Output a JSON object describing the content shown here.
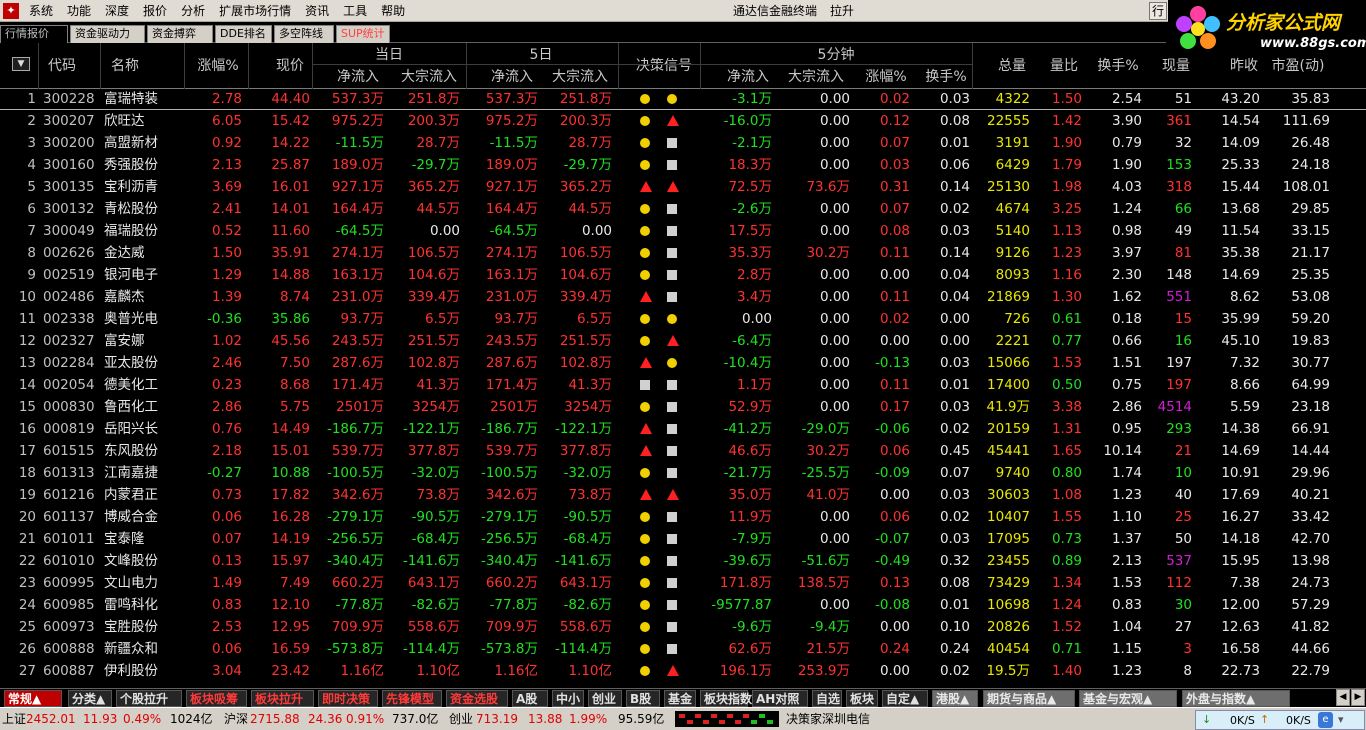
{
  "menubar": {
    "logo_icon": "app-logo-icon",
    "items": [
      "系统",
      "功能",
      "深度",
      "报价",
      "分析",
      "扩展市场行情",
      "资讯",
      "工具",
      "帮助"
    ],
    "app_title": "通达信金融终端",
    "pull_label": "拉升",
    "corner_label": "行"
  },
  "brand": {
    "text": "分析家公式网",
    "url": "www.88gs.com"
  },
  "top_tabs": [
    "行情报价",
    "资金驱动力",
    "资金搏弈",
    "DDE排名",
    "多空阵线",
    "SUP统计"
  ],
  "header": {
    "group_today": "当日",
    "group_5day": "5日",
    "group_5min": "5分钟",
    "code": "代码",
    "name": "名称",
    "pct": "涨幅%",
    "price": "现价",
    "net_inflow": "净流入",
    "block_inflow": "大宗流入",
    "signal": "决策信号",
    "pct5": "涨幅%",
    "turnover5": "换手%",
    "volume": "总量",
    "vol_ratio": "量比",
    "turnover": "换手%",
    "cur_vol": "现量",
    "prev_close": "昨收",
    "pe": "市盈(动)"
  },
  "colors": {
    "up": "#ff3232",
    "down": "#20e020",
    "flat": "#e8e8e8",
    "volume": "#e8e800",
    "magenta": "#d020d0",
    "signal_circle": "#f0d000",
    "signal_square": "#d0d0d0",
    "signal_triangle": "#ff2020"
  },
  "rows": [
    {
      "n": "1",
      "code": "300228",
      "name": "富瑞特装",
      "pct": "2.78",
      "price": "44.40",
      "t_net": "537.3万",
      "t_blk": "251.8万",
      "d_net": "537.3万",
      "d_blk": "251.8万",
      "s1": "circle",
      "s2": "circle",
      "m_net": "-3.1万",
      "m_blk": "0.00",
      "m_pct": "0.02",
      "m_to": "0.03",
      "vol": "4322",
      "vr": "1.50",
      "to": "2.54",
      "cv": "51",
      "pc": "43.20",
      "pe": "35.83"
    },
    {
      "n": "2",
      "code": "300207",
      "name": "欣旺达",
      "pct": "6.05",
      "price": "15.42",
      "t_net": "975.2万",
      "t_blk": "200.3万",
      "d_net": "975.2万",
      "d_blk": "200.3万",
      "s1": "circle",
      "s2": "triangle",
      "m_net": "-16.0万",
      "m_blk": "0.00",
      "m_pct": "0.12",
      "m_to": "0.08",
      "vol": "22555",
      "vr": "1.42",
      "to": "3.90",
      "cv": "361",
      "pc": "14.54",
      "pe": "111.69"
    },
    {
      "n": "3",
      "code": "300200",
      "name": "高盟新材",
      "pct": "0.92",
      "price": "14.22",
      "t_net": "-11.5万",
      "t_blk": "28.7万",
      "d_net": "-11.5万",
      "d_blk": "28.7万",
      "s1": "circle",
      "s2": "square",
      "m_net": "-2.1万",
      "m_blk": "0.00",
      "m_pct": "0.07",
      "m_to": "0.01",
      "vol": "3191",
      "vr": "1.90",
      "to": "0.79",
      "cv": "32",
      "pc": "14.09",
      "pe": "26.48"
    },
    {
      "n": "4",
      "code": "300160",
      "name": "秀强股份",
      "pct": "2.13",
      "price": "25.87",
      "t_net": "189.0万",
      "t_blk": "-29.7万",
      "d_net": "189.0万",
      "d_blk": "-29.7万",
      "s1": "circle",
      "s2": "square",
      "m_net": "18.3万",
      "m_blk": "0.00",
      "m_pct": "0.03",
      "m_to": "0.06",
      "vol": "6429",
      "vr": "1.79",
      "to": "1.90",
      "cv": "153",
      "pc": "25.33",
      "pe": "24.18"
    },
    {
      "n": "5",
      "code": "300135",
      "name": "宝利沥青",
      "pct": "3.69",
      "price": "16.01",
      "t_net": "927.1万",
      "t_blk": "365.2万",
      "d_net": "927.1万",
      "d_blk": "365.2万",
      "s1": "triangle",
      "s2": "triangle",
      "m_net": "72.5万",
      "m_blk": "73.6万",
      "m_pct": "0.31",
      "m_to": "0.14",
      "vol": "25130",
      "vr": "1.98",
      "to": "4.03",
      "cv": "318",
      "pc": "15.44",
      "pe": "108.01"
    },
    {
      "n": "6",
      "code": "300132",
      "name": "青松股份",
      "pct": "2.41",
      "price": "14.01",
      "t_net": "164.4万",
      "t_blk": "44.5万",
      "d_net": "164.4万",
      "d_blk": "44.5万",
      "s1": "circle",
      "s2": "square",
      "m_net": "-2.6万",
      "m_blk": "0.00",
      "m_pct": "0.07",
      "m_to": "0.02",
      "vol": "4674",
      "vr": "3.25",
      "to": "1.24",
      "cv": "66",
      "pc": "13.68",
      "pe": "29.85"
    },
    {
      "n": "7",
      "code": "300049",
      "name": "福瑞股份",
      "pct": "0.52",
      "price": "11.60",
      "t_net": "-64.5万",
      "t_blk": "0.00",
      "d_net": "-64.5万",
      "d_blk": "0.00",
      "s1": "circle",
      "s2": "square",
      "m_net": "17.5万",
      "m_blk": "0.00",
      "m_pct": "0.08",
      "m_to": "0.03",
      "vol": "5140",
      "vr": "1.13",
      "to": "0.98",
      "cv": "49",
      "pc": "11.54",
      "pe": "33.15"
    },
    {
      "n": "8",
      "code": "002626",
      "name": "金达威",
      "pct": "1.50",
      "price": "35.91",
      "t_net": "274.1万",
      "t_blk": "106.5万",
      "d_net": "274.1万",
      "d_blk": "106.5万",
      "s1": "circle",
      "s2": "square",
      "m_net": "35.3万",
      "m_blk": "30.2万",
      "m_pct": "0.11",
      "m_to": "0.14",
      "vol": "9126",
      "vr": "1.23",
      "to": "3.97",
      "cv": "81",
      "pc": "35.38",
      "pe": "21.17"
    },
    {
      "n": "9",
      "code": "002519",
      "name": "银河电子",
      "pct": "1.29",
      "price": "14.88",
      "t_net": "163.1万",
      "t_blk": "104.6万",
      "d_net": "163.1万",
      "d_blk": "104.6万",
      "s1": "circle",
      "s2": "square",
      "m_net": "2.8万",
      "m_blk": "0.00",
      "m_pct": "0.00",
      "m_to": "0.04",
      "vol": "8093",
      "vr": "1.16",
      "to": "2.30",
      "cv": "148",
      "pc": "14.69",
      "pe": "25.35"
    },
    {
      "n": "10",
      "code": "002486",
      "name": "嘉麟杰",
      "pct": "1.39",
      "price": "8.74",
      "t_net": "231.0万",
      "t_blk": "339.4万",
      "d_net": "231.0万",
      "d_blk": "339.4万",
      "s1": "triangle",
      "s2": "square",
      "m_net": "3.4万",
      "m_blk": "0.00",
      "m_pct": "0.11",
      "m_to": "0.04",
      "vol": "21869",
      "vr": "1.30",
      "to": "1.62",
      "cv": "551",
      "pc": "8.62",
      "pe": "53.08"
    },
    {
      "n": "11",
      "code": "002338",
      "name": "奥普光电",
      "pct": "-0.36",
      "price": "35.86",
      "t_net": "93.7万",
      "t_blk": "6.5万",
      "d_net": "93.7万",
      "d_blk": "6.5万",
      "s1": "circle",
      "s2": "circle",
      "m_net": "0.00",
      "m_blk": "0.00",
      "m_pct": "0.02",
      "m_to": "0.00",
      "vol": "726",
      "vr": "0.61",
      "to": "0.18",
      "cv": "15",
      "pc": "35.99",
      "pe": "59.20"
    },
    {
      "n": "12",
      "code": "002327",
      "name": "富安娜",
      "pct": "1.02",
      "price": "45.56",
      "t_net": "243.5万",
      "t_blk": "251.5万",
      "d_net": "243.5万",
      "d_blk": "251.5万",
      "s1": "circle",
      "s2": "triangle",
      "m_net": "-6.4万",
      "m_blk": "0.00",
      "m_pct": "0.00",
      "m_to": "0.00",
      "vol": "2221",
      "vr": "0.77",
      "to": "0.66",
      "cv": "16",
      "pc": "45.10",
      "pe": "19.83"
    },
    {
      "n": "13",
      "code": "002284",
      "name": "亚太股份",
      "pct": "2.46",
      "price": "7.50",
      "t_net": "287.6万",
      "t_blk": "102.8万",
      "d_net": "287.6万",
      "d_blk": "102.8万",
      "s1": "triangle",
      "s2": "circle",
      "m_net": "-10.4万",
      "m_blk": "0.00",
      "m_pct": "-0.13",
      "m_to": "0.03",
      "vol": "15066",
      "vr": "1.53",
      "to": "1.51",
      "cv": "197",
      "pc": "7.32",
      "pe": "30.77"
    },
    {
      "n": "14",
      "code": "002054",
      "name": "德美化工",
      "pct": "0.23",
      "price": "8.68",
      "t_net": "171.4万",
      "t_blk": "41.3万",
      "d_net": "171.4万",
      "d_blk": "41.3万",
      "s1": "square",
      "s2": "square",
      "m_net": "1.1万",
      "m_blk": "0.00",
      "m_pct": "0.11",
      "m_to": "0.01",
      "vol": "17400",
      "vr": "0.50",
      "to": "0.75",
      "cv": "197",
      "pc": "8.66",
      "pe": "64.99"
    },
    {
      "n": "15",
      "code": "000830",
      "name": "鲁西化工",
      "pct": "2.86",
      "price": "5.75",
      "t_net": "2501万",
      "t_blk": "3254万",
      "d_net": "2501万",
      "d_blk": "3254万",
      "s1": "circle",
      "s2": "square",
      "m_net": "52.9万",
      "m_blk": "0.00",
      "m_pct": "0.17",
      "m_to": "0.03",
      "vol": "41.9万",
      "vr": "3.38",
      "to": "2.86",
      "cv": "4514",
      "pc": "5.59",
      "pe": "23.18"
    },
    {
      "n": "16",
      "code": "000819",
      "name": "岳阳兴长",
      "pct": "0.76",
      "price": "14.49",
      "t_net": "-186.7万",
      "t_blk": "-122.1万",
      "d_net": "-186.7万",
      "d_blk": "-122.1万",
      "s1": "triangle",
      "s2": "square",
      "m_net": "-41.2万",
      "m_blk": "-29.0万",
      "m_pct": "-0.06",
      "m_to": "0.02",
      "vol": "20159",
      "vr": "1.31",
      "to": "0.95",
      "cv": "293",
      "pc": "14.38",
      "pe": "66.91"
    },
    {
      "n": "17",
      "code": "601515",
      "name": "东风股份",
      "pct": "2.18",
      "price": "15.01",
      "t_net": "539.7万",
      "t_blk": "377.8万",
      "d_net": "539.7万",
      "d_blk": "377.8万",
      "s1": "triangle",
      "s2": "square",
      "m_net": "46.6万",
      "m_blk": "30.2万",
      "m_pct": "0.06",
      "m_to": "0.45",
      "vol": "45441",
      "vr": "1.65",
      "to": "10.14",
      "cv": "21",
      "pc": "14.69",
      "pe": "14.44"
    },
    {
      "n": "18",
      "code": "601313",
      "name": "江南嘉捷",
      "pct": "-0.27",
      "price": "10.88",
      "t_net": "-100.5万",
      "t_blk": "-32.0万",
      "d_net": "-100.5万",
      "d_blk": "-32.0万",
      "s1": "circle",
      "s2": "square",
      "m_net": "-21.7万",
      "m_blk": "-25.5万",
      "m_pct": "-0.09",
      "m_to": "0.07",
      "vol": "9740",
      "vr": "0.80",
      "to": "1.74",
      "cv": "10",
      "pc": "10.91",
      "pe": "29.96"
    },
    {
      "n": "19",
      "code": "601216",
      "name": "内蒙君正",
      "pct": "0.73",
      "price": "17.82",
      "t_net": "342.6万",
      "t_blk": "73.8万",
      "d_net": "342.6万",
      "d_blk": "73.8万",
      "s1": "triangle",
      "s2": "triangle",
      "m_net": "35.0万",
      "m_blk": "41.0万",
      "m_pct": "0.00",
      "m_to": "0.03",
      "vol": "30603",
      "vr": "1.08",
      "to": "1.23",
      "cv": "40",
      "pc": "17.69",
      "pe": "40.21"
    },
    {
      "n": "20",
      "code": "601137",
      "name": "博威合金",
      "pct": "0.06",
      "price": "16.28",
      "t_net": "-279.1万",
      "t_blk": "-90.5万",
      "d_net": "-279.1万",
      "d_blk": "-90.5万",
      "s1": "circle",
      "s2": "square",
      "m_net": "11.9万",
      "m_blk": "0.00",
      "m_pct": "0.06",
      "m_to": "0.02",
      "vol": "10407",
      "vr": "1.55",
      "to": "1.10",
      "cv": "25",
      "pc": "16.27",
      "pe": "33.42"
    },
    {
      "n": "21",
      "code": "601011",
      "name": "宝泰隆",
      "pct": "0.07",
      "price": "14.19",
      "t_net": "-256.5万",
      "t_blk": "-68.4万",
      "d_net": "-256.5万",
      "d_blk": "-68.4万",
      "s1": "circle",
      "s2": "square",
      "m_net": "-7.9万",
      "m_blk": "0.00",
      "m_pct": "-0.07",
      "m_to": "0.03",
      "vol": "17095",
      "vr": "0.73",
      "to": "1.37",
      "cv": "50",
      "pc": "14.18",
      "pe": "42.70"
    },
    {
      "n": "22",
      "code": "601010",
      "name": "文峰股份",
      "pct": "0.13",
      "price": "15.97",
      "t_net": "-340.4万",
      "t_blk": "-141.6万",
      "d_net": "-340.4万",
      "d_blk": "-141.6万",
      "s1": "circle",
      "s2": "square",
      "m_net": "-39.6万",
      "m_blk": "-51.6万",
      "m_pct": "-0.49",
      "m_to": "0.32",
      "vol": "23455",
      "vr": "0.89",
      "to": "2.13",
      "cv": "537",
      "pc": "15.95",
      "pe": "13.98"
    },
    {
      "n": "23",
      "code": "600995",
      "name": "文山电力",
      "pct": "1.49",
      "price": "7.49",
      "t_net": "660.2万",
      "t_blk": "643.1万",
      "d_net": "660.2万",
      "d_blk": "643.1万",
      "s1": "circle",
      "s2": "square",
      "m_net": "171.8万",
      "m_blk": "138.5万",
      "m_pct": "0.13",
      "m_to": "0.08",
      "vol": "73429",
      "vr": "1.34",
      "to": "1.53",
      "cv": "112",
      "pc": "7.38",
      "pe": "24.73"
    },
    {
      "n": "24",
      "code": "600985",
      "name": "雷鸣科化",
      "pct": "0.83",
      "price": "12.10",
      "t_net": "-77.8万",
      "t_blk": "-82.6万",
      "d_net": "-77.8万",
      "d_blk": "-82.6万",
      "s1": "circle",
      "s2": "square",
      "m_net": "-9577.87",
      "m_blk": "0.00",
      "m_pct": "-0.08",
      "m_to": "0.01",
      "vol": "10698",
      "vr": "1.24",
      "to": "0.83",
      "cv": "30",
      "pc": "12.00",
      "pe": "57.29"
    },
    {
      "n": "25",
      "code": "600973",
      "name": "宝胜股份",
      "pct": "2.53",
      "price": "12.95",
      "t_net": "709.9万",
      "t_blk": "558.6万",
      "d_net": "709.9万",
      "d_blk": "558.6万",
      "s1": "circle",
      "s2": "square",
      "m_net": "-9.6万",
      "m_blk": "-9.4万",
      "m_pct": "0.00",
      "m_to": "0.10",
      "vol": "20826",
      "vr": "1.52",
      "to": "1.04",
      "cv": "27",
      "pc": "12.63",
      "pe": "41.82"
    },
    {
      "n": "26",
      "code": "600888",
      "name": "新疆众和",
      "pct": "0.06",
      "price": "16.59",
      "t_net": "-573.8万",
      "t_blk": "-114.4万",
      "d_net": "-573.8万",
      "d_blk": "-114.4万",
      "s1": "circle",
      "s2": "square",
      "m_net": "62.6万",
      "m_blk": "21.5万",
      "m_pct": "0.24",
      "m_to": "0.24",
      "vol": "40454",
      "vr": "0.71",
      "to": "1.15",
      "cv": "3",
      "pc": "16.58",
      "pe": "44.66"
    },
    {
      "n": "27",
      "code": "600887",
      "name": "伊利股份",
      "pct": "3.04",
      "price": "23.42",
      "t_net": "1.16亿",
      "t_blk": "1.10亿",
      "d_net": "1.16亿",
      "d_blk": "1.10亿",
      "s1": "circle",
      "s2": "triangle",
      "m_net": "196.1万",
      "m_blk": "253.9万",
      "m_pct": "0.00",
      "m_to": "0.02",
      "vol": "19.5万",
      "vr": "1.40",
      "to": "1.23",
      "cv": "8",
      "pc": "22.73",
      "pe": "22.79"
    }
  ],
  "bottom_tabs": [
    "常规▲",
    "分类▲",
    "个股拉升",
    "板块吸筹",
    "板块拉升",
    "即时决策",
    "先锋模型",
    "资金选股",
    "A股",
    "中小",
    "创业",
    "B股",
    "基金",
    "板块指数",
    "AH对照",
    "自选",
    "板块",
    "自定▲",
    "港股▲",
    "期货与商品▲",
    "基金与宏观▲",
    "外盘与指数▲"
  ],
  "status": {
    "sh_label": "上证",
    "sh_value": "2452.01",
    "sh_change": "11.93",
    "sh_pct": "0.49%",
    "sh_amount": "1024亿",
    "hs_label": "沪深",
    "hs_value": "2715.88",
    "hs_change": "24.36",
    "hs_pct": "0.91%",
    "hs_amount": "737.0亿",
    "cy_label": "创业",
    "cy_value": "713.19",
    "cy_change": "13.88",
    "cy_pct": "1.99%",
    "cy_amount": "95.59亿",
    "server": "决策家深圳电信",
    "down_speed": "0K/S",
    "up_speed": "0K/S"
  }
}
